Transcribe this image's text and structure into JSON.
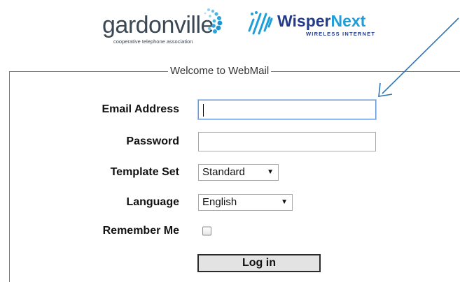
{
  "header": {
    "gardonville": {
      "name": "gardonville",
      "tagline": "cooperative telephone association",
      "dot_color": "#2aa3de"
    },
    "wisper": {
      "name_part1": "Wisper",
      "name_part2": "Next",
      "subtitle": "WIRELESS INTERNET",
      "color_dark": "#243b8a",
      "color_light": "#1f9ed8"
    }
  },
  "login": {
    "legend": "Welcome to WebMail",
    "email_label": "Email Address",
    "email_value": "",
    "password_label": "Password",
    "password_value": "",
    "template_label": "Template Set",
    "template_selected": "Standard",
    "language_label": "Language",
    "language_selected": "English",
    "remember_label": "Remember Me",
    "remember_checked": false,
    "login_button": "Log in"
  },
  "annotation": {
    "arrow_color": "#2e74b5",
    "points_to": "email-address-input"
  }
}
